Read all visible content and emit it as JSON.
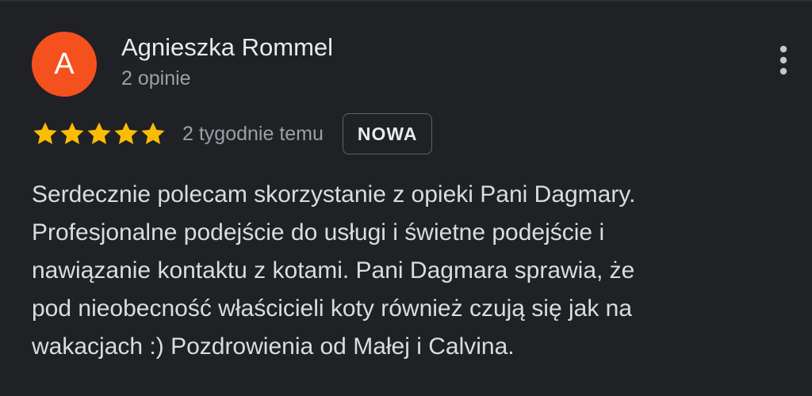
{
  "review": {
    "author": {
      "initial": "A",
      "name": "Agnieszka Rommel",
      "meta": "2 opinie",
      "avatar_color": "#f4511e"
    },
    "rating": {
      "stars": 5,
      "max": 5,
      "star_color": "#fbbc04"
    },
    "date": "2 tygodnie temu",
    "badge": "NOWA",
    "text_lines": [
      "Serdecznie polecam skorzystanie z opieki Pani Dagmary.",
      "Profesjonalne podejście do usługi i świetne podejście i",
      "nawiązanie kontaktu z kotami. Pani Dagmara sprawia, że",
      "pod nieobecność właścicieli koty również czują się jak na",
      "wakacjach :) Pozdrowienia od Małej i Calvina."
    ],
    "more_icon": "more-vert-icon"
  }
}
